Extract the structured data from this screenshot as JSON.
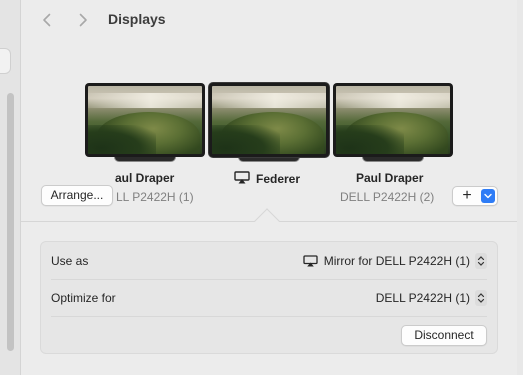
{
  "window": {
    "title": "Displays"
  },
  "toolbar": {
    "back_icon": "chevron-left-icon",
    "forward_icon": "chevron-right-icon"
  },
  "displays": [
    {
      "name": "Paul Draper",
      "visible_name": "aul Draper",
      "model": "DELL P2422H (1)",
      "visible_model": "LL P2422H (1)",
      "selected": false
    },
    {
      "name": "Federer",
      "model": "",
      "icon": "airplay-icon",
      "selected": true
    },
    {
      "name": "Paul Draper",
      "model": "DELL P2422H (2)",
      "selected": false
    }
  ],
  "buttons": {
    "arrange": "Arrange...",
    "add": "+",
    "disconnect": "Disconnect"
  },
  "settings": {
    "use_as": {
      "label": "Use as",
      "value": "Mirror for DELL P2422H (1)",
      "icon": "airplay-icon"
    },
    "optimize_for": {
      "label": "Optimize for",
      "value": "DELL P2422H (1)"
    }
  },
  "colors": {
    "accent": "#2e7cf6",
    "background": "#ececec",
    "secondary_text": "#808080"
  }
}
